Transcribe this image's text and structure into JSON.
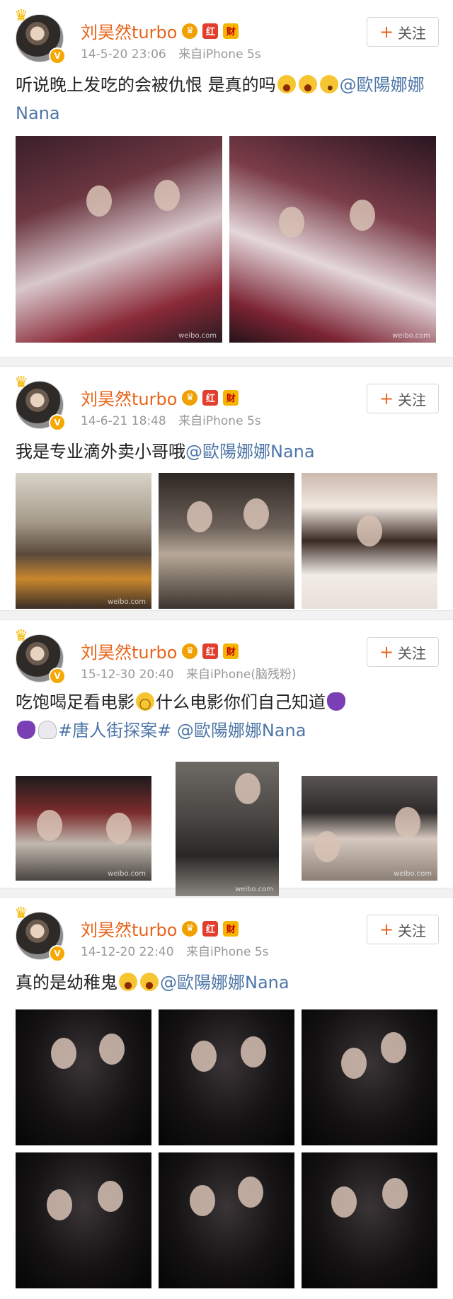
{
  "posts": [
    {
      "username": "刘昊然turbo",
      "time": "14-5-20 23:06",
      "source": "来自iPhone 5s",
      "follow_label": "关注",
      "text_before": "听说晚上发吃的会被仇恨 是真的吗",
      "mention": "@歐陽娜娜Nana",
      "photo_count": 2
    },
    {
      "username": "刘昊然turbo",
      "time": "14-6-21 18:48",
      "source": "来自iPhone 5s",
      "follow_label": "关注",
      "text_before": "我是专业滴外卖小哥哦",
      "mention": "@歐陽娜娜Nana",
      "photo_count": 3
    },
    {
      "username": "刘昊然turbo",
      "time": "15-12-30 20:40",
      "source": "来自iPhone(脑残粉)",
      "follow_label": "关注",
      "text_before": "吃饱喝足看电影",
      "text_middle": "什么电影你们自己知道",
      "hashtag": "#唐人街探案#",
      "mention": "@歐陽娜娜Nana",
      "photo_count": 3
    },
    {
      "username": "刘昊然turbo",
      "time": "14-12-20 22:40",
      "source": "来自iPhone 5s",
      "follow_label": "关注",
      "text_before": "真的是幼稚鬼",
      "mention": "@歐陽娜娜Nana",
      "photo_count": 6
    }
  ],
  "badges": {
    "vip": "♛",
    "red": "红",
    "cai": "财",
    "verified": "V"
  },
  "watermark": "weibo.com"
}
